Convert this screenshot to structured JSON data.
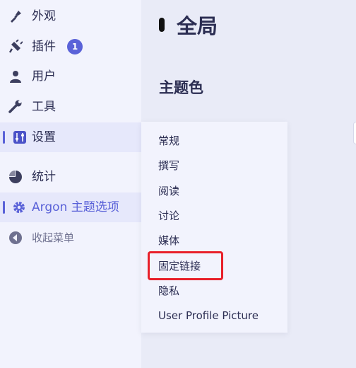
{
  "sidebar": {
    "items": [
      {
        "label": "外观",
        "icon": "paint-brush-icon"
      },
      {
        "label": "插件",
        "icon": "plug-icon",
        "badge": "1"
      },
      {
        "label": "用户",
        "icon": "user-icon"
      },
      {
        "label": "工具",
        "icon": "wrench-icon"
      },
      {
        "label": "设置",
        "icon": "settings-sliders-icon"
      },
      {
        "label": "统计",
        "icon": "pie-chart-icon"
      },
      {
        "label": "Argon 主题选项",
        "icon": "gear-icon"
      },
      {
        "label": "收起菜单",
        "icon": "collapse-arrow-icon"
      }
    ]
  },
  "settings_submenu": {
    "items": [
      "常规",
      "撰写",
      "阅读",
      "讨论",
      "媒体",
      "固定链接",
      "隐私",
      "User Profile Picture"
    ]
  },
  "main": {
    "title": "全局",
    "section_title": "主题色"
  },
  "colors": {
    "accent": "#5a62d8",
    "highlight": "#e8202a",
    "text": "#2b2d52"
  }
}
